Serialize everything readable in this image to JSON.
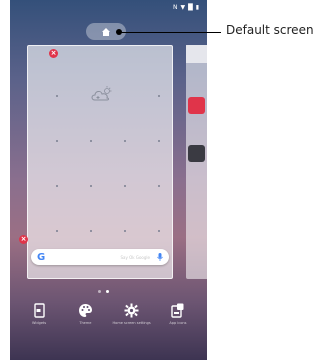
{
  "callout": {
    "label": "Default screen"
  },
  "status_bar": {
    "icons": [
      "nfc-icon",
      "wifi-icon",
      "signal-icon",
      "battery-icon"
    ],
    "time": ""
  },
  "home_screen": {
    "home_button_icon": "home-icon",
    "widget_icon": "weather-cloud-plus-icon",
    "search_bar": {
      "logo": "G",
      "hint": "Say Ok Google"
    },
    "page_count": 2,
    "active_page": 1
  },
  "toolbar": {
    "items": [
      {
        "icon": "widgets-icon",
        "label": "Widgets"
      },
      {
        "icon": "palette-icon",
        "label": "Theme"
      },
      {
        "icon": "gear-icon",
        "label": "Home screen settings"
      },
      {
        "icon": "app-icons-icon",
        "label": "App icons"
      }
    ]
  },
  "colors": {
    "remove_badge": "#e0344a",
    "callout_line": "#000000",
    "google_blue": "#4285f4"
  }
}
